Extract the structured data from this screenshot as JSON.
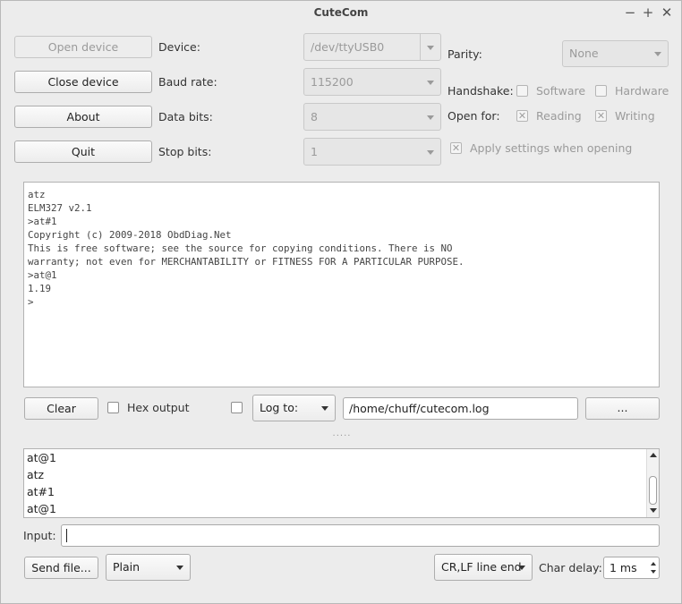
{
  "window": {
    "title": "CuteCom"
  },
  "buttons": {
    "open_device": "Open device",
    "close_device": "Close device",
    "about": "About",
    "quit": "Quit",
    "clear": "Clear",
    "browse": "...",
    "send_file": "Send file..."
  },
  "settings": {
    "device_label": "Device:",
    "device_value": "/dev/ttyUSB0",
    "baud_label": "Baud rate:",
    "baud_value": "115200",
    "databits_label": "Data bits:",
    "databits_value": "8",
    "stopbits_label": "Stop bits:",
    "stopbits_value": "1",
    "parity_label": "Parity:",
    "parity_value": "None",
    "handshake_label": "Handshake:",
    "handshake_software": "Software",
    "handshake_hardware": "Hardware",
    "openfor_label": "Open for:",
    "openfor_reading": "Reading",
    "openfor_writing": "Writing",
    "apply_settings": "Apply settings when opening"
  },
  "terminal": {
    "lines": [
      "atz",
      "ELM327 v2.1",
      ">at#1",
      "Copyright (c) 2009-2018 ObdDiag.Net",
      "This is free software; see the source for copying conditions. There is NO",
      "warranty; not even for MERCHANTABILITY or FITNESS FOR A PARTICULAR PURPOSE.",
      ">at@1",
      "1.19",
      ">"
    ]
  },
  "log": {
    "hex_output": "Hex output",
    "log_mode": "Log to:",
    "log_path": "/home/chuff/cutecom.log"
  },
  "history": {
    "items": [
      "at@1",
      "atz",
      "at#1",
      "at@1"
    ]
  },
  "input": {
    "label": "Input:",
    "value": ""
  },
  "bottom": {
    "send_mode": "Plain",
    "line_end": "CR,LF line end",
    "char_delay_label": "Char delay:",
    "char_delay_value": "1 ms"
  },
  "colors": {
    "window_bg": "#ececec",
    "terminal_bg": "#ffffff",
    "disabled_text": "#9a9a9a"
  },
  "splitter": {
    "handle": "....."
  }
}
